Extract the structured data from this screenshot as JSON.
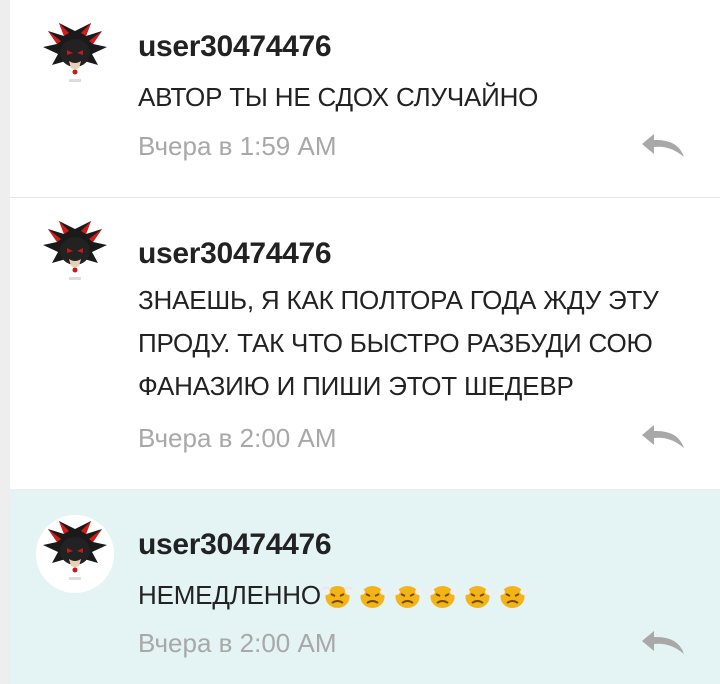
{
  "comments": [
    {
      "username": "user30474476",
      "text": "АВТОР ТЫ НЕ СДОХ СЛУЧАЙНО",
      "time": "Вчера в 1:59 AM",
      "highlighted": false
    },
    {
      "username": "user30474476",
      "text": "ЗНАЕШЬ, Я КАК ПОЛТОРА ГОДА ЖДУ ЭТУ ПРОДУ. ТАК ЧТО БЫСТРО РАЗБУДИ СОЮ ФАНАЗИЮ И ПИШИ ЭТОТ ШЕДЕВР",
      "time": "Вчера в 2:00 AM",
      "highlighted": false
    },
    {
      "username": "user30474476",
      "text": "НЕМЕДЛЕННО",
      "emoji": [
        "angry-face-emoji",
        "angry-face-emoji",
        "angry-face-emoji",
        "angry-face-emoji",
        "angry-face-emoji",
        "angry-face-emoji"
      ],
      "time": "Вчера в 2:00 AM",
      "highlighted": true
    }
  ],
  "icons": {
    "avatar": "shadow-hedgehog-avatar-icon",
    "reply": "reply-arrow-icon"
  },
  "colors": {
    "background": "#eeeeee",
    "card": "#ffffff",
    "highlighted_card": "#e4f3f3",
    "username": "#222222",
    "message": "#222222",
    "timestamp": "#a8a8a8",
    "reply_icon": "#a8a8a8"
  }
}
